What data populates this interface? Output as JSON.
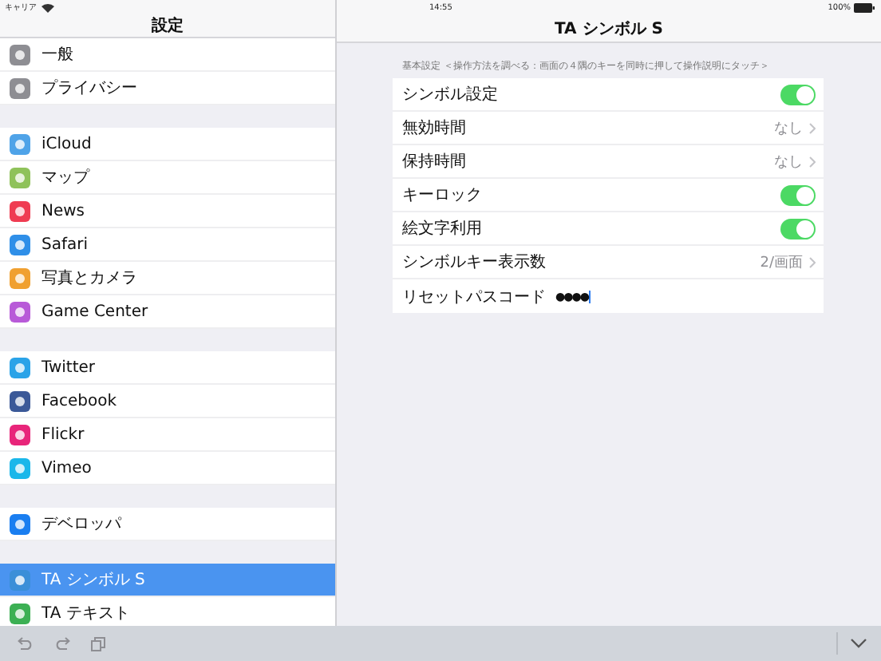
{
  "status_bar": {
    "carrier": "キャリア",
    "time": "14:55",
    "battery": "100%"
  },
  "sidebar": {
    "title": "設定",
    "groups": [
      [
        {
          "label": "一般",
          "color": "#8e8e93",
          "selected": false
        },
        {
          "label": "プライバシー",
          "color": "#8e8e93",
          "selected": false
        }
      ],
      [
        {
          "label": "iCloud",
          "color": "#4fa3e8",
          "selected": false
        },
        {
          "label": "マップ",
          "color": "#8fc25a",
          "selected": false
        },
        {
          "label": "News",
          "color": "#ef3c52",
          "selected": false
        },
        {
          "label": "Safari",
          "color": "#2f8fe8",
          "selected": false
        },
        {
          "label": "写真とカメラ",
          "color": "#f0a030",
          "selected": false
        },
        {
          "label": "Game Center",
          "color": "#b85ad8",
          "selected": false
        }
      ],
      [
        {
          "label": "Twitter",
          "color": "#2aa3e8",
          "selected": false
        },
        {
          "label": "Facebook",
          "color": "#3b5998",
          "selected": false
        },
        {
          "label": "Flickr",
          "color": "#e8257a",
          "selected": false
        },
        {
          "label": "Vimeo",
          "color": "#1ab7ea",
          "selected": false
        }
      ],
      [
        {
          "label": "デベロッパ",
          "color": "#1a7ef0",
          "selected": false
        }
      ],
      [
        {
          "label": "TA シンボル S",
          "color": "#3a8fd8",
          "selected": true
        },
        {
          "label": "TA テキスト",
          "color": "#3cb054",
          "selected": false
        }
      ]
    ]
  },
  "detail": {
    "title": "TA シンボル S",
    "section_header": "基本設定 ＜操作方法を調べる：画面の４隅のキーを同時に押して操作説明にタッチ＞",
    "rows": [
      {
        "kind": "toggle",
        "label": "シンボル設定",
        "on": true
      },
      {
        "kind": "disclosure",
        "label": "無効時間",
        "value": "なし"
      },
      {
        "kind": "disclosure",
        "label": "保持時間",
        "value": "なし"
      },
      {
        "kind": "toggle",
        "label": "キーロック",
        "on": true
      },
      {
        "kind": "toggle",
        "label": "絵文字利用",
        "on": true
      },
      {
        "kind": "disclosure",
        "label": "シンボルキー表示数",
        "value": "2/画面"
      },
      {
        "kind": "passcode",
        "label": "リセットパスコード",
        "value": "●●●●"
      }
    ]
  }
}
